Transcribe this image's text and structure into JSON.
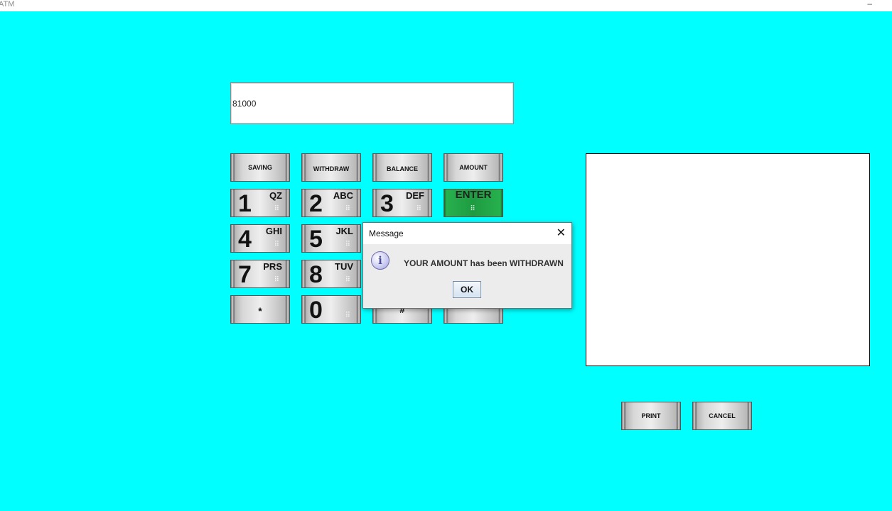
{
  "window": {
    "title": "ATM",
    "minimize_glyph": "–"
  },
  "display": {
    "value": "81000"
  },
  "function_keys": [
    {
      "label": "SAVING"
    },
    {
      "label": "WITHDRAW"
    },
    {
      "label": "BALANCE"
    },
    {
      "label": "AMOUNT"
    }
  ],
  "keypad": {
    "k1": {
      "digit": "1",
      "letters": "QZ"
    },
    "k2": {
      "digit": "2",
      "letters": "ABC"
    },
    "k3": {
      "digit": "3",
      "letters": "DEF"
    },
    "k4": {
      "digit": "4",
      "letters": "GHI"
    },
    "k5": {
      "digit": "5",
      "letters": "JKL"
    },
    "k7": {
      "digit": "7",
      "letters": "PRS"
    },
    "k8": {
      "digit": "8",
      "letters": "TUV"
    },
    "k0": {
      "digit": "0"
    },
    "star": {
      "label": "*"
    },
    "hash": {
      "label": "#"
    },
    "enter": {
      "label": "ENTER"
    },
    "braille_dots": "⠿"
  },
  "bottom_buttons": {
    "print": "PRINT",
    "cancel": "CANCEL"
  },
  "dialog": {
    "title": "Message",
    "close_glyph": "✕",
    "icon": "info-icon",
    "icon_glyph": "i",
    "message": "YOUR AMOUNT has been WITHDRAWN",
    "ok_label": "OK"
  },
  "colors": {
    "background": "#00ffff",
    "enter_key": "#1e9b41"
  }
}
